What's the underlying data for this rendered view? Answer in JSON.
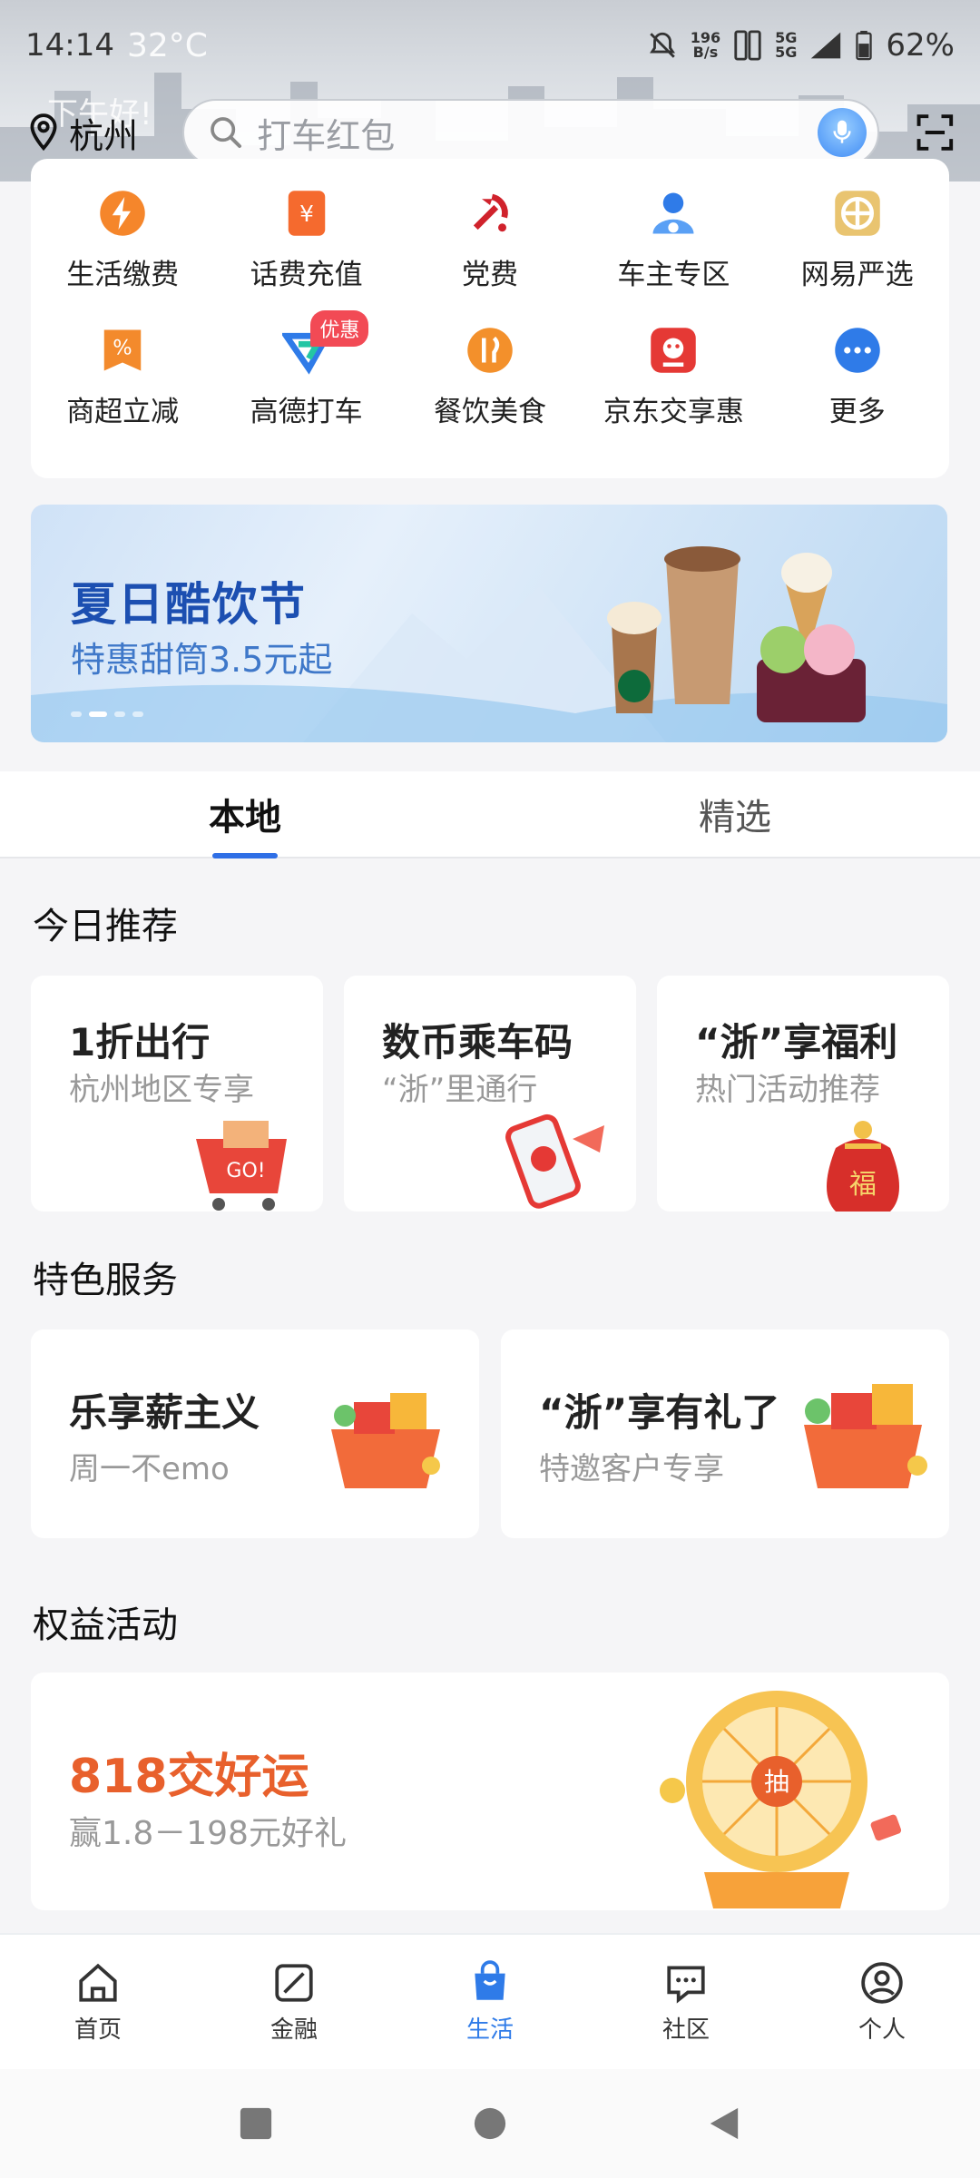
{
  "status": {
    "time": "14:14",
    "weather": "32°C",
    "net_speed": "196\nB/s",
    "net_type": "5G",
    "battery": "62%"
  },
  "greeting": "下午好!",
  "location": {
    "city": "杭州"
  },
  "search": {
    "placeholder": "打车红包"
  },
  "services": [
    {
      "label": "生活缴费",
      "icon": "bolt-icon",
      "color": "#f5862b"
    },
    {
      "label": "话费充值",
      "icon": "yuan-icon",
      "color": "#f56a2e"
    },
    {
      "label": "党费",
      "icon": "party-emblem-icon",
      "color": "#d0222c"
    },
    {
      "label": "车主专区",
      "icon": "driver-icon",
      "color": "#2f7be8"
    },
    {
      "label": "网易严选",
      "icon": "shop-icon",
      "color": "#e9b740"
    },
    {
      "label": "商超立减",
      "icon": "discount-icon",
      "color": "#f38a2c"
    },
    {
      "label": "高德打车",
      "icon": "gaode-icon",
      "color": "#2f7be8",
      "badge": "优惠"
    },
    {
      "label": "餐饮美食",
      "icon": "food-icon",
      "color": "#f3902b"
    },
    {
      "label": "京东交享惠",
      "icon": "jd-icon",
      "color": "#e53935"
    },
    {
      "label": "更多",
      "icon": "more-icon",
      "color": "#2f7be8"
    }
  ],
  "banner": {
    "title": "夏日酷饮节",
    "subtitle": "特惠甜筒3.5元起"
  },
  "tabs": [
    {
      "label": "本地"
    },
    {
      "label": "精选"
    }
  ],
  "today": {
    "title": "今日推荐",
    "cards": [
      {
        "title": "1折出行",
        "subtitle": "杭州地区专享",
        "icon": "shopping-cart-icon"
      },
      {
        "title": "数币乘车码",
        "subtitle": "“浙”里通行",
        "icon": "phone-icon"
      },
      {
        "title": "“浙”享福利",
        "subtitle": "热门活动推荐",
        "icon": "lucky-bag-icon"
      }
    ]
  },
  "featured": {
    "title": "特色服务",
    "cards": [
      {
        "title": "乐享薪主义",
        "subtitle": "周一不emo",
        "icon": "gift-basket-icon"
      },
      {
        "title": "“浙”享有礼了",
        "subtitle": "特邀客户专享",
        "icon": "gift-basket-icon"
      }
    ]
  },
  "benefits": {
    "title": "权益活动",
    "card": {
      "title": "818交好运",
      "subtitle": "赢1.8－198元好礼",
      "icon": "lucky-wheel-icon",
      "wheel_text": "抽"
    }
  },
  "bottom_nav": [
    {
      "label": "首页",
      "icon": "home-icon"
    },
    {
      "label": "金融",
      "icon": "finance-icon"
    },
    {
      "label": "生活",
      "icon": "life-bag-icon"
    },
    {
      "label": "社区",
      "icon": "community-icon"
    },
    {
      "label": "个人",
      "icon": "profile-icon"
    }
  ],
  "active_nav": "生活",
  "colors": {
    "accent": "#2f7be8",
    "orange": "#e8602c"
  }
}
